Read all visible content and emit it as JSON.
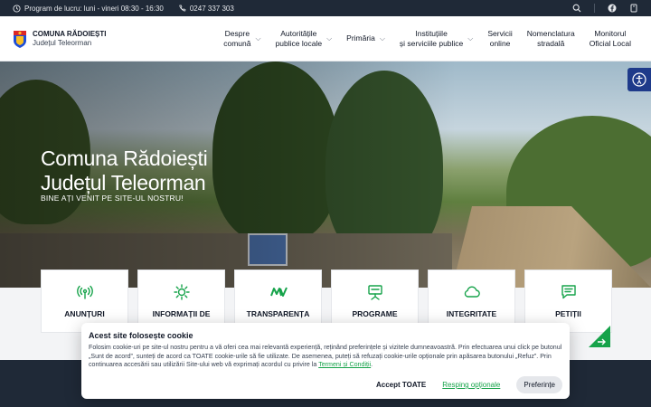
{
  "topbar": {
    "schedule": "Program de lucru: luni - vineri 08:30 - 16:30",
    "phone": "0247 337 303"
  },
  "brand": {
    "title": "COMUNA RĂDOIEȘTI",
    "subtitle": "Județul Teleorman"
  },
  "nav": {
    "items": [
      {
        "label": "Despre\ncomună",
        "dropdown": true
      },
      {
        "label": "Autoritățile\npublice locale",
        "dropdown": true
      },
      {
        "label": "Primăria",
        "dropdown": true
      },
      {
        "label": "Instituțiile\nși serviciile publice",
        "dropdown": true
      },
      {
        "label": "Servicii\nonline",
        "dropdown": false
      },
      {
        "label": "Nomenclatura\nstradală",
        "dropdown": false
      },
      {
        "label": "Monitorul\nOficial Local",
        "dropdown": false
      }
    ]
  },
  "hero": {
    "title_line1": "Comuna Rădoiești",
    "title_line2": "Județul Teleorman",
    "subtitle": "BINE AȚI VENIT PE SITE-UL NOSTRU!"
  },
  "cards": [
    {
      "label": "ANUNȚURI",
      "icon": "broadcast-icon"
    },
    {
      "label": "INFORMAȚII DE",
      "icon": "sun-icon"
    },
    {
      "label": "TRANSPARENȚA",
      "icon": "mv-logo-icon"
    },
    {
      "label": "PROGRAME",
      "icon": "presentation-board-icon"
    },
    {
      "label": "INTEGRITATE",
      "icon": "cloud-icon"
    },
    {
      "label": "PETIȚII",
      "icon": "message-icon"
    }
  ],
  "cookie": {
    "title": "Acest site folosește cookie",
    "text": "Folosim cookie-uri pe site-ul nostru pentru a vă oferi cea mai relevantă experiență, reținând preferințele și vizitele dumneavoastră. Prin efectuarea unui click pe butonul „Sunt de acord”, sunteți de acord ca TOATE cookie-urile să fie utilizate. De asemenea, puteți să refuzați cookie-urile opționale prin apăsarea butonului „Refuz”. Prin continuarea accesării sau utilizării Site-ului web vă exprimați acordul cu privire la ",
    "link": "Termeni și Condiții",
    "text_end": ".",
    "accept": "Accept TOATE",
    "reject": "Resping opționale",
    "preferences": "Preferințe"
  },
  "colors": {
    "accent": "#16a34a",
    "topbar": "#1f2937",
    "a11y": "#1e3a8a"
  }
}
